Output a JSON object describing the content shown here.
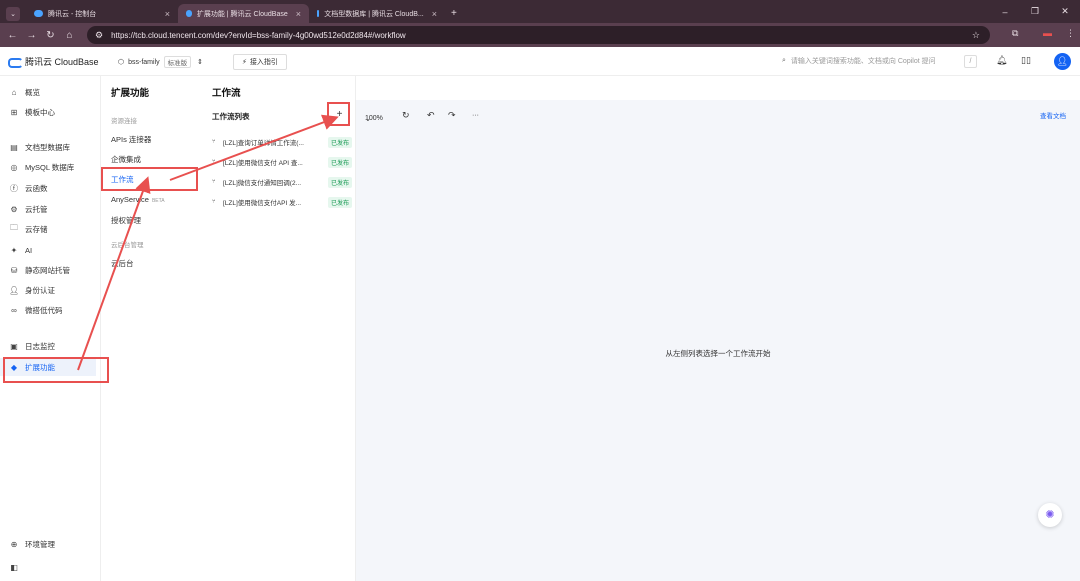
{
  "browser": {
    "tabs": [
      {
        "label": "腾讯云 - 控制台",
        "active": false
      },
      {
        "label": "扩展功能 | 腾讯云 CloudBase",
        "active": true
      },
      {
        "label": "文档型数据库 | 腾讯云 CloudB...",
        "active": false
      }
    ],
    "new_tab": "+",
    "url": "https://tcb.cloud.tencent.com/dev?envId=bss-family-4g00wd512e0d2d84#/workflow"
  },
  "header": {
    "logo": "腾讯云 CloudBase",
    "env_name": "bss-family",
    "env_badge": "标准版",
    "guide_button": "接入指引",
    "search_placeholder": "请输入关键词搜索功能、文档或向 Copilot 提问",
    "search_shortcut": "/"
  },
  "sidebar": {
    "items": [
      {
        "label": "概览",
        "icon": "home-icon"
      },
      {
        "label": "模板中心",
        "icon": "grid-icon"
      },
      {
        "label": "文档型数据库",
        "icon": "document-db-icon"
      },
      {
        "label": "MySQL 数据库",
        "icon": "mysql-icon"
      },
      {
        "label": "云函数",
        "icon": "function-icon"
      },
      {
        "label": "云托管",
        "icon": "cloud-run-icon"
      },
      {
        "label": "云存储",
        "icon": "storage-icon"
      },
      {
        "label": "AI",
        "icon": "ai-sparkle-icon"
      },
      {
        "label": "静态网站托管",
        "icon": "static-site-icon"
      },
      {
        "label": "身份认证",
        "icon": "user-auth-icon"
      },
      {
        "label": "微搭低代码",
        "icon": "lowcode-icon"
      },
      {
        "label": "日志监控",
        "icon": "log-monitor-icon"
      },
      {
        "label": "扩展功能",
        "icon": "extension-icon"
      }
    ],
    "footer": [
      {
        "label": "环境管理",
        "icon": "globe-icon"
      },
      {
        "label": "",
        "icon": "collapse-sidebar-icon"
      }
    ]
  },
  "subnav": {
    "title": "扩展功能",
    "group1": "资源连接",
    "items1": [
      "APIs 连接器",
      "企微集成",
      "工作流",
      "AnyService",
      "授权管理"
    ],
    "anyservice_tag": "BETA",
    "group2": "云后台管理",
    "items2": [
      "云后台"
    ]
  },
  "workflow": {
    "page_title": "工作流",
    "list_title": "工作流列表",
    "add_button": "+",
    "rows": [
      {
        "name": "[LZL]查询订单详情工作流(...",
        "status": "已发布"
      },
      {
        "name": "[LZL]使用微信支付 API 查...",
        "status": "已发布"
      },
      {
        "name": "[LZL]微信支付通知回调(2...",
        "status": "已发布"
      },
      {
        "name": "[LZL]使用微信支付API 发...",
        "status": "已发布"
      }
    ]
  },
  "toolbar": {
    "zoom": "100%",
    "more": "···",
    "doc_link": "查看文档"
  },
  "canvas": {
    "empty_text": "从左侧列表选择一个工作流开始"
  },
  "colors": {
    "brand": "#1463f3",
    "annotation": "#e8504f",
    "published_bg": "#e6f7ee",
    "published_text": "#1a9a54"
  }
}
